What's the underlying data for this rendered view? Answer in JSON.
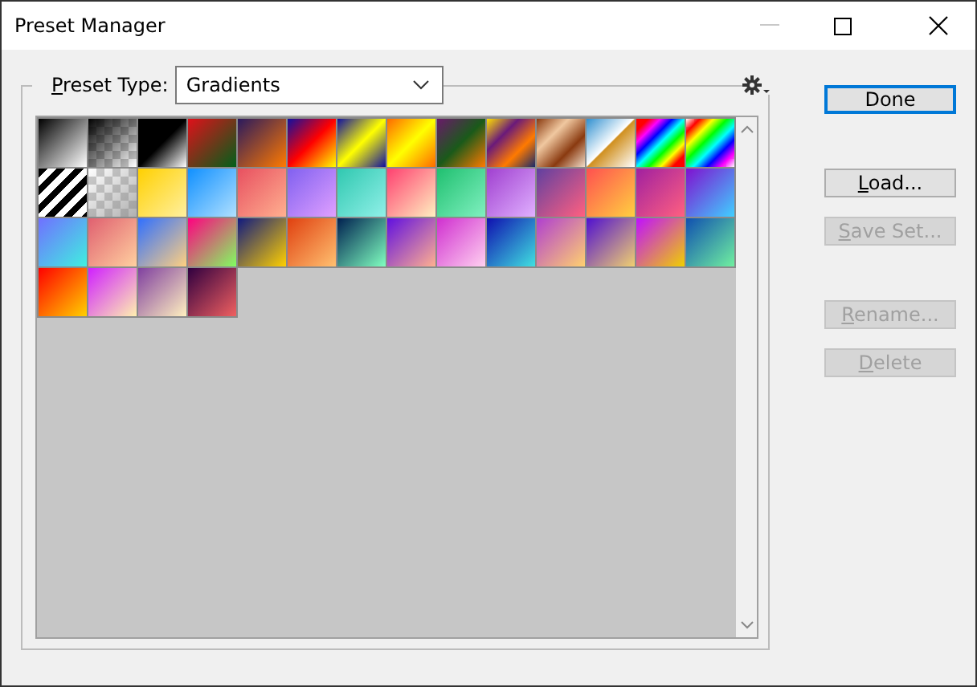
{
  "window": {
    "title": "Preset Manager",
    "minimize_disabled": true
  },
  "preset_type": {
    "label": "Preset Type:",
    "value": "Gradients"
  },
  "buttons": [
    {
      "label": "Done",
      "default": true,
      "disabled": false,
      "mnemonic": false
    },
    {
      "label": "Load...",
      "default": false,
      "disabled": false,
      "mnemonic": true
    },
    {
      "label": "Save Set...",
      "default": false,
      "disabled": true,
      "mnemonic": true
    },
    {
      "label": "Rename...",
      "default": false,
      "disabled": true,
      "mnemonic": true
    },
    {
      "label": "Delete",
      "default": false,
      "disabled": true,
      "mnemonic": true
    }
  ]
}
